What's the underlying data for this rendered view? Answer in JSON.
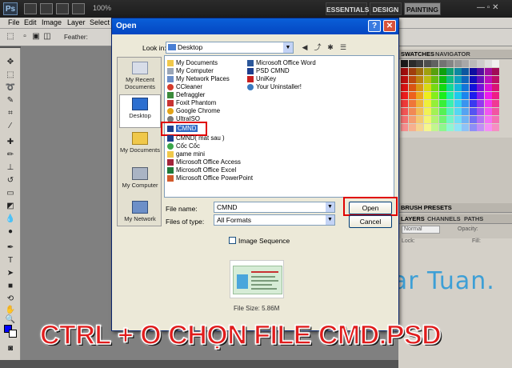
{
  "photoshop": {
    "logo": "Ps",
    "zoom": "100%",
    "workspaces": [
      "ESSENTIALS",
      "DESIGN",
      "PAINTING"
    ],
    "active_workspace": "PAINTING",
    "window_controls": "— ▫ ✕",
    "menu": [
      "File",
      "Edit",
      "Image",
      "Layer",
      "Select"
    ],
    "options": {
      "feather_label": "Feather:"
    },
    "panels": {
      "swatches_tab": "SWATCHES",
      "navigator_tab": "NAVIGATOR",
      "brush_presets_tab": "BRUSH PRESETS",
      "layers_tab": "LAYERS",
      "channels_tab": "CHANNELS",
      "paths_tab": "PATHS",
      "blend_mode": "Normal",
      "opacity_label": "Opacity:",
      "lock_label": "Lock:",
      "fill_label": "Fill:"
    },
    "colors": {
      "foreground": "#0000ff",
      "background": "#ffffff"
    }
  },
  "dialog": {
    "title": "Open",
    "help": "?",
    "close": "✕",
    "look_in_label": "Look in:",
    "look_in_value": "Desktop",
    "places": [
      "My Recent Documents",
      "Desktop",
      "My Documents",
      "My Computer",
      "My Network"
    ],
    "active_place": "Desktop",
    "files_col1": [
      "My Documents",
      "My Computer",
      "My Network Places",
      "CCleaner",
      "Defraggler",
      "Foxit Phantom",
      "Google Chrome",
      "UltraISO",
      "CMND",
      "CMND( mat sau )",
      "Cốc Cốc",
      "game mini",
      "Microsoft Office Access",
      "Microsoft Office Excel",
      "Microsoft Office PowerPoint"
    ],
    "files_col2": [
      "Microsoft Office Word",
      "PSD CMND",
      "UniKey",
      "Your Uninstaller!"
    ],
    "selected_file": "CMND",
    "file_name_label": "File name:",
    "file_name_value": "CMND",
    "file_type_label": "Files of type:",
    "file_type_value": "All Formats",
    "open_button": "Open",
    "cancel_button": "Cancel",
    "image_sequence_label": "Image Sequence",
    "image_sequence_checked": false,
    "file_size": "File Size: 5.86M"
  },
  "overlay": {
    "watermark": "Star Tuan.",
    "caption": "CTRL + O CHỌN FILE CMD.PSD"
  }
}
